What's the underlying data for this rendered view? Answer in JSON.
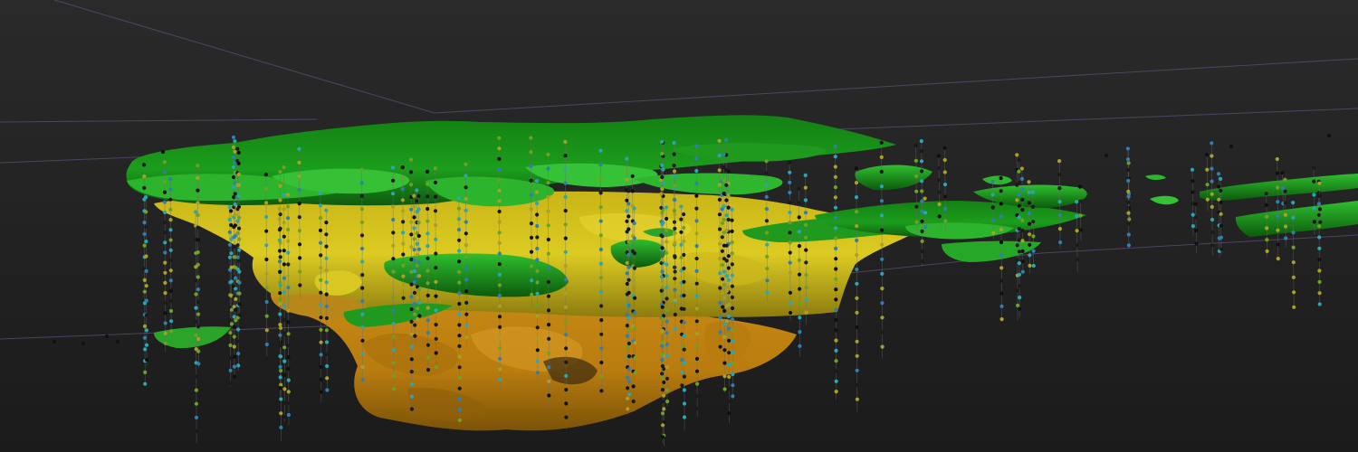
{
  "scene": {
    "background_top": "#2a2a2a",
    "background_bottom": "#1b1b1b",
    "bounding_box_color": "#6a4a8a",
    "layers": [
      {
        "name": "upper-surface",
        "color": "#1f9a1f",
        "dark": "#126112"
      },
      {
        "name": "middle-surface",
        "color": "#d6c21a",
        "dark": "#8e7e10"
      },
      {
        "name": "lower-surface",
        "color": "#c98a12",
        "dark": "#7a5208"
      }
    ],
    "drillhole_colors": [
      "#1a1a1a",
      "#2aa7b5",
      "#6ea124",
      "#2f7fb0",
      "#a9a126",
      "#101010"
    ]
  }
}
